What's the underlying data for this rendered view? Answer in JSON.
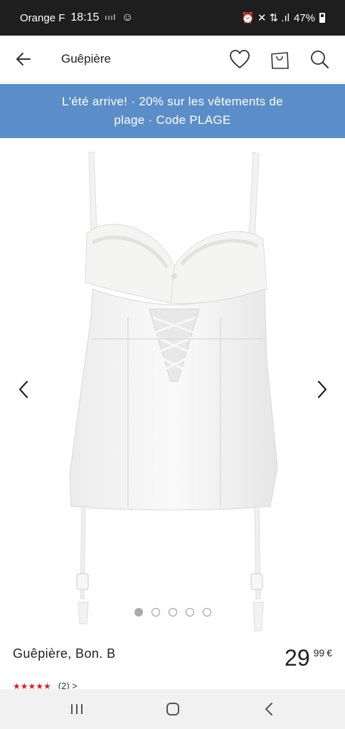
{
  "status_bar": {
    "carrier": "Orange F",
    "time": "18:15",
    "signal_text": "ıııl",
    "icons_right": "⏰ ✕ ⇅ .ıl",
    "battery": "47%"
  },
  "app_bar": {
    "title": "Guêpière",
    "icons": [
      "back-arrow-icon",
      "heart-icon",
      "shopping-bag-icon",
      "search-icon"
    ]
  },
  "promo": {
    "line1": "L'été arrive! · 20% sur les vêtements de",
    "line2": "plage · Code PLAGE",
    "color": "#5b8dc9"
  },
  "carousel": {
    "image_count": 5,
    "active_index": 0,
    "icons": [
      "chevron-left-icon",
      "chevron-right-icon"
    ]
  },
  "product": {
    "name": "Guêpière, Bon. B",
    "price_integer": "29",
    "price_decimal": "99",
    "currency": "€",
    "stars": "★★★★★",
    "rating_count": "(2) >",
    "star_color": "#d0202a"
  },
  "nav_bar": {
    "icons": [
      "recent-apps-icon",
      "home-icon",
      "back-icon"
    ]
  }
}
